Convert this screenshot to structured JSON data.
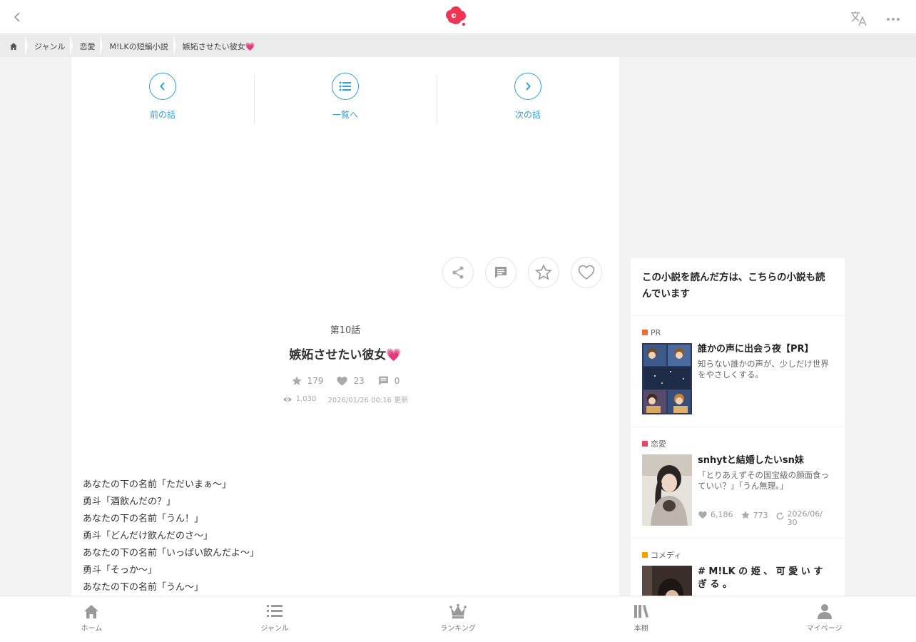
{
  "breadcrumb": {
    "items": [
      "ジャンル",
      "恋愛",
      "M!LKの短編小説",
      "嫉妬させたい彼女💗"
    ]
  },
  "episode_nav": {
    "prev_label": "前の話",
    "list_label": "一覧へ",
    "next_label": "次の話"
  },
  "episode": {
    "number": "第10話",
    "title": "嫉妬させたい彼女💗",
    "stars": "179",
    "hearts": "23",
    "comments": "0",
    "views": "1,030",
    "updated": "2026/01/26 00:16 更新"
  },
  "body_lines": [
    "あなたの下の名前「ただいまぁ〜」",
    "勇斗「酒飲んだの？」",
    "あなたの下の名前「うん！」",
    "勇斗「どんだけ飲んだのさ〜」",
    "あなたの下の名前「いっぱい飲んだよ〜」",
    "勇斗「そっか〜」",
    "あなたの下の名前「うん〜」"
  ],
  "sidebar": {
    "heading": "この小説を読んだ方は、こちらの小説も読んでいます",
    "cards": [
      {
        "tag": "PR",
        "tag_color": "#f06a33",
        "title": "誰かの声に出会う夜【PR】",
        "desc": "知らない誰かの声が、少しだけ世界をやさしくする。"
      },
      {
        "tag": "恋愛",
        "tag_color": "#e9456b",
        "title": "snhytと結婚したいsn妹",
        "desc": "「とりあえずその国宝級の顔面食っていい？」「うん無理。」",
        "hearts": "6,186",
        "stars": "773",
        "updated": "2026/06/30"
      },
      {
        "tag": "コメディ",
        "tag_color": "#f5a300",
        "title": "# M!LK の 姫 、 可 愛 い す ぎ る 。"
      }
    ]
  },
  "tabbar": {
    "home": "ホーム",
    "genre": "ジャンル",
    "ranking": "ランキング",
    "bookshelf": "本棚",
    "mypage": "マイページ"
  },
  "colors": {
    "accent": "#29a3d8",
    "logo": "#ee3553"
  }
}
